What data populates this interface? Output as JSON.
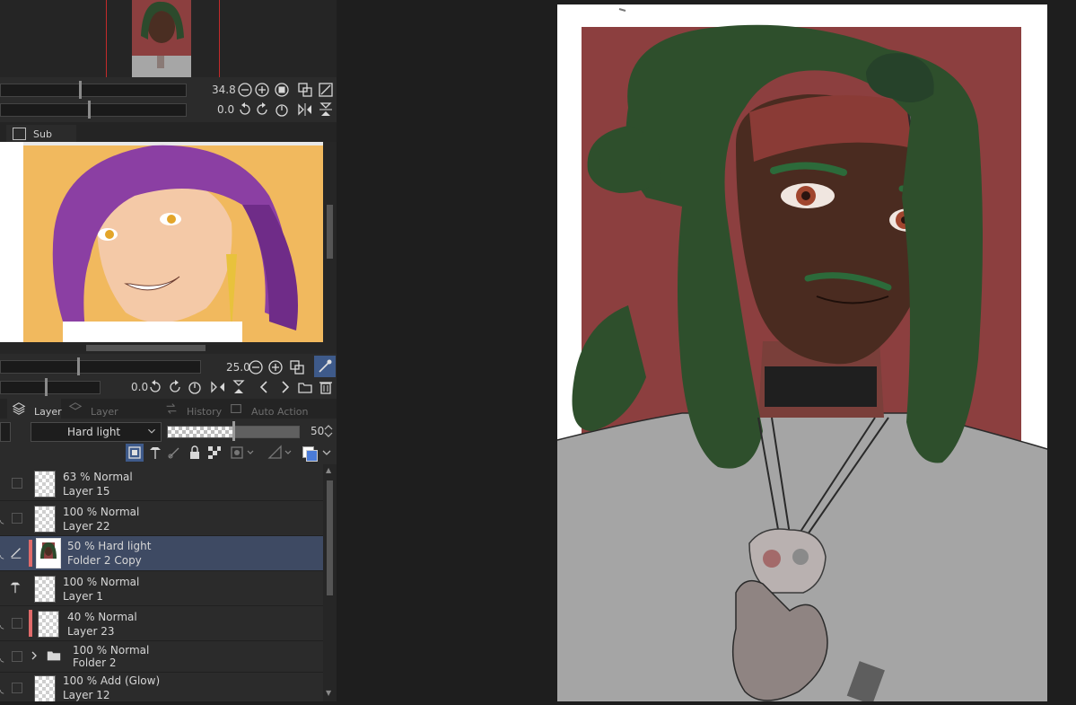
{
  "navigator": {
    "zoom_value": "34.8",
    "rotate_value": "0.0"
  },
  "subview": {
    "tab_label": "Sub View",
    "zoom_value": "25.0",
    "rotate_value": "0.0"
  },
  "panel_tabs": [
    {
      "label": "Layer",
      "active": true
    },
    {
      "label": "Layer Property",
      "active": false
    },
    {
      "label": "History",
      "active": false
    },
    {
      "label": "Auto Action",
      "active": false
    }
  ],
  "layer_controls": {
    "blend_mode": "Hard light",
    "opacity": "50",
    "opacity_fraction": 0.5
  },
  "layers": [
    {
      "mode": "63 % Normal",
      "name": "Layer 15",
      "selected": false,
      "color_label": false,
      "folder": false
    },
    {
      "mode": "100 % Normal",
      "name": "Layer 22",
      "selected": false,
      "color_label": false,
      "folder": false
    },
    {
      "mode": "50 % Hard light",
      "name": "Folder 2 Copy",
      "selected": true,
      "color_label": true,
      "folder": false
    },
    {
      "mode": "100 % Normal",
      "name": "Layer 1",
      "selected": false,
      "color_label": false,
      "folder": false
    },
    {
      "mode": "40 % Normal",
      "name": "Layer 23",
      "selected": false,
      "color_label": true,
      "folder": false
    },
    {
      "mode": "100 % Normal",
      "name": "Folder 2",
      "selected": false,
      "color_label": false,
      "folder": true
    },
    {
      "mode": "100 % Add (Glow)",
      "name": "Layer 12",
      "selected": false,
      "color_label": false,
      "folder": false
    }
  ],
  "colors": {
    "panel_bg": "#2b2b2b",
    "selection": "#3e4a63",
    "accent_blue": "#4a7bd8",
    "color_label": "#e06a6a",
    "canvas_bg": "#1e1e1e",
    "art_red": "#8c3f3f",
    "art_green": "#2c4a2c"
  }
}
